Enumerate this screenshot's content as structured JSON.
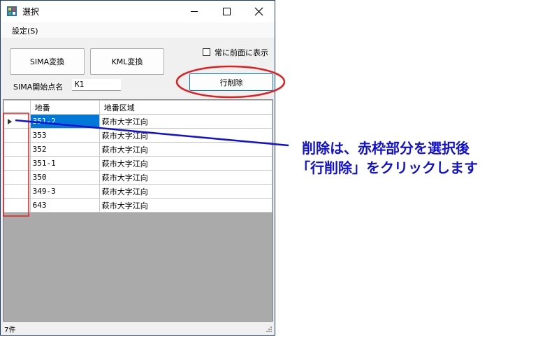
{
  "window": {
    "title": "選択"
  },
  "menu": {
    "settings": "設定(S)"
  },
  "buttons": {
    "sima_convert": "SIMA変換",
    "kml_convert": "KML変換",
    "delete_row": "行削除"
  },
  "options": {
    "always_on_top_label": "常に前面に表示",
    "always_on_top_checked": false
  },
  "sima_start": {
    "label": "SIMA開始点名",
    "value": "K1"
  },
  "grid": {
    "columns": [
      "地番",
      "地番区域"
    ],
    "rows": [
      {
        "lot": "351-2",
        "area": "萩市大字江向",
        "selected": true
      },
      {
        "lot": "353",
        "area": "萩市大字江向"
      },
      {
        "lot": "352",
        "area": "萩市大字江向"
      },
      {
        "lot": "351-1",
        "area": "萩市大字江向"
      },
      {
        "lot": "350",
        "area": "萩市大字江向"
      },
      {
        "lot": "349-3",
        "area": "萩市大字江向"
      },
      {
        "lot": "643",
        "area": "萩市大字江向"
      }
    ]
  },
  "status": {
    "count": "7件"
  },
  "annotation": {
    "line1": "削除は、赤枠部分を選択後",
    "line2": "「行削除」をクリックします"
  },
  "colors": {
    "annotation_blue": "#1010d8",
    "highlight_red": "#e02020",
    "selection": "#0078d7"
  }
}
